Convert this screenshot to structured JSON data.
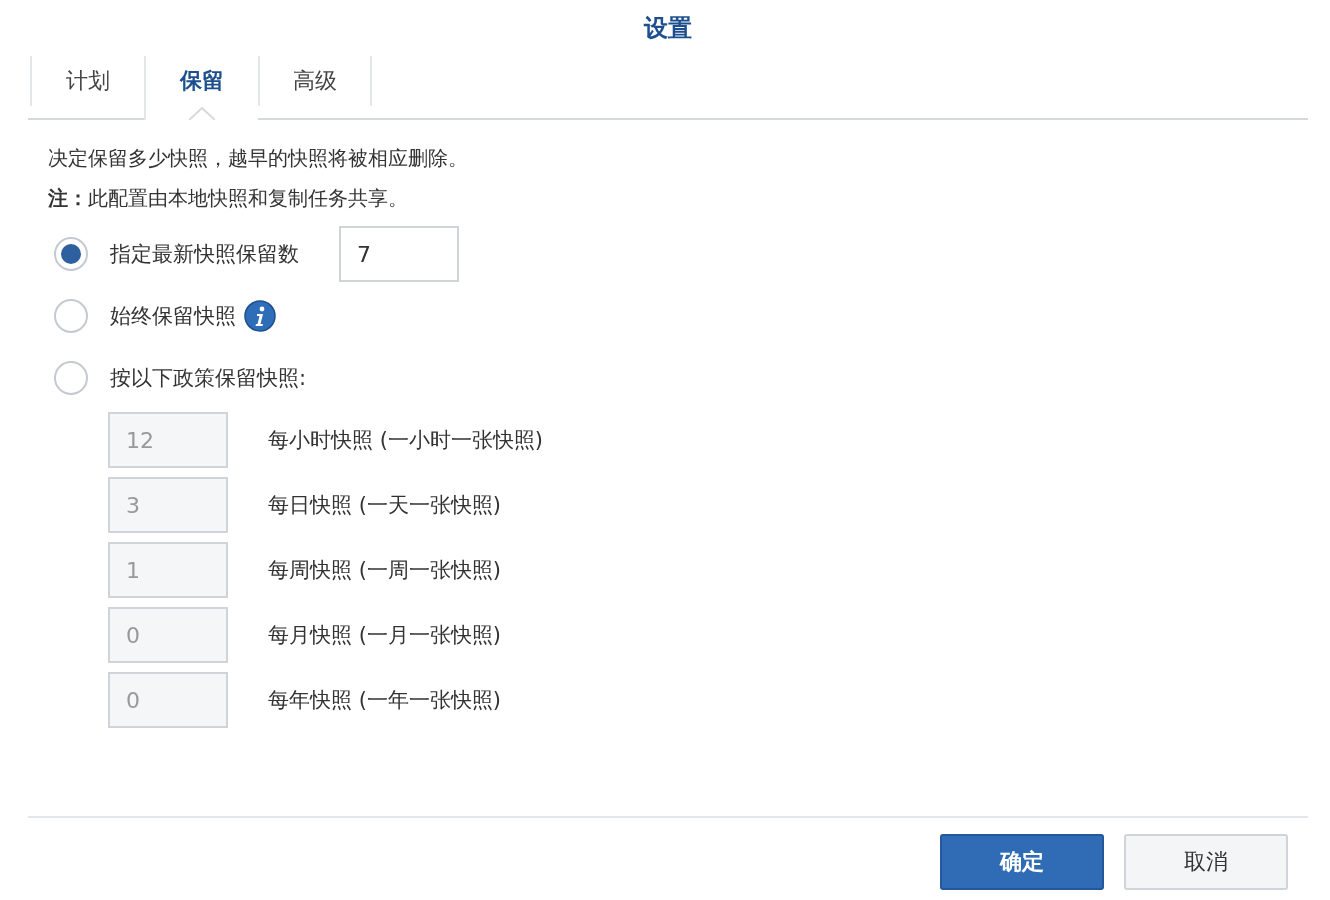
{
  "window": {
    "title": "设置"
  },
  "tabs": [
    {
      "label": "计划",
      "selected": false
    },
    {
      "label": "保留",
      "selected": true
    },
    {
      "label": "高级",
      "selected": false
    }
  ],
  "description": [
    "决定保留多少快照，越早的快照将被相应删除。",
    "**注：**此配置由本地快照和复制任务共享。"
  ],
  "options": [
    {
      "kind": "field",
      "label": "指定最新快照保留数",
      "selected": true,
      "value": "7"
    },
    {
      "kind": "info",
      "label": "始终保留快照",
      "selected": false
    },
    {
      "kind": "plain",
      "label": "按以下政策保留快照:",
      "selected": false
    }
  ],
  "policy": [
    {
      "value": "12",
      "label": "每小时快照 (一小时一张快照)",
      "disabled": true
    },
    {
      "value": "3",
      "label": "每日快照 (一天一张快照)",
      "disabled": true
    },
    {
      "value": "1",
      "label": "每周快照 (一周一张快照)",
      "disabled": true
    },
    {
      "value": "0",
      "label": "每月快照 (一月一张快照)",
      "disabled": true
    },
    {
      "value": "0",
      "label": "每年快照 (一年一张快照)",
      "disabled": true
    }
  ],
  "buttons": [
    {
      "label": "确定",
      "kind": "primary"
    },
    {
      "label": "取消",
      "kind": "secondary"
    }
  ]
}
